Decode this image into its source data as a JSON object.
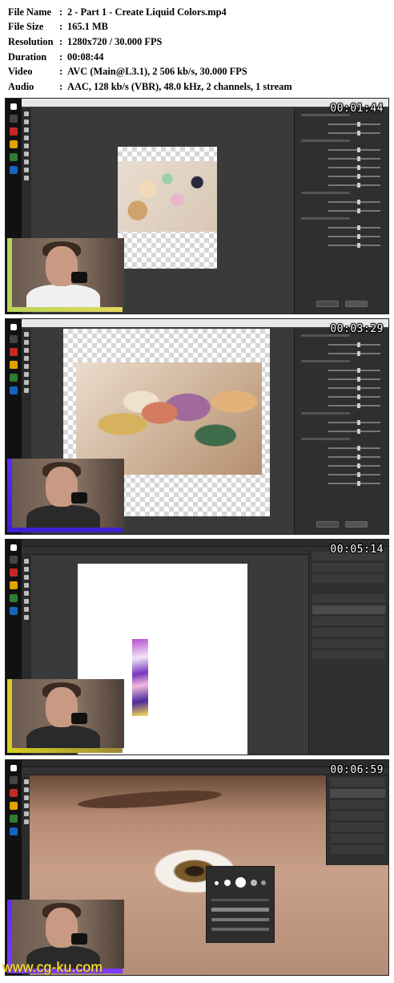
{
  "metadata": [
    {
      "key": "File Name",
      "value": "2 - Part 1 - Create Liquid Colors.mp4"
    },
    {
      "key": "File Size",
      "value": "165.1 MB"
    },
    {
      "key": "Resolution",
      "value": "1280x720 / 30.000 FPS"
    },
    {
      "key": "Duration",
      "value": "00:08:44"
    },
    {
      "key": "Video",
      "value": "AVC (Main@L3.1), 2 506 kb/s, 30.000 FPS"
    },
    {
      "key": "Audio",
      "value": "AAC, 128 kb/s (VBR), 48.0 kHz, 2 channels, 1 stream"
    }
  ],
  "colon": ":",
  "frames": [
    {
      "timestamp": "00:01:44"
    },
    {
      "timestamp": "00:03:29"
    },
    {
      "timestamp": "00:05:14"
    },
    {
      "timestamp": "00:06:59"
    }
  ],
  "watermark": "www.cg-ku.com",
  "colors": {
    "timestamp_text": "#ffffff",
    "watermark_text": "#ffe94a",
    "ps_dark": "#2b2b2b",
    "webcam_accent_1": "#d8d020",
    "webcam_accent_2": "#5a2cff"
  }
}
